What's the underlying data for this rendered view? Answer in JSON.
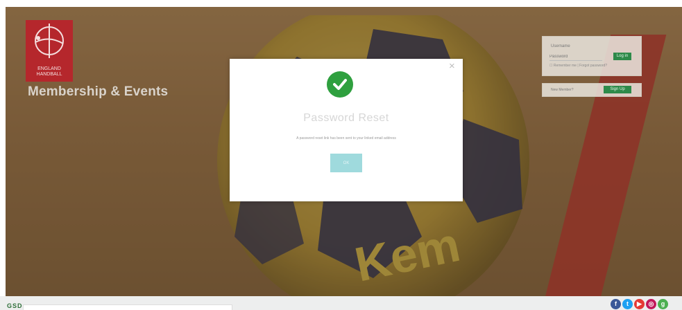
{
  "brand": {
    "logo_text": "ENGLAND\nHANDBALL",
    "title": "Membership & Events"
  },
  "login": {
    "label": "Username",
    "password_placeholder": "Password",
    "login_button": "Log in",
    "remember_text": "Remember me",
    "forgot_text": "Forgot password?"
  },
  "signup": {
    "label": "New Member?",
    "button": "Sign Up"
  },
  "modal": {
    "close_label": "×",
    "title": "Password Reset",
    "message": "A password reset link has been sent to your linked email address",
    "ok_label": "OK"
  },
  "footer": {
    "logo_text": "GSD",
    "social_icons": [
      "facebook-icon",
      "twitter-icon",
      "youtube-icon",
      "instagram-icon",
      "google-icon"
    ],
    "social_colors": [
      "#3b5998",
      "#1da1f2",
      "#e53935",
      "#c2185b",
      "#4caf50"
    ]
  },
  "colors": {
    "brand_red": "#b5272c",
    "green_button": "#2e8a4a",
    "success_green": "#2fa03f",
    "ok_button": "#9fdadd"
  }
}
